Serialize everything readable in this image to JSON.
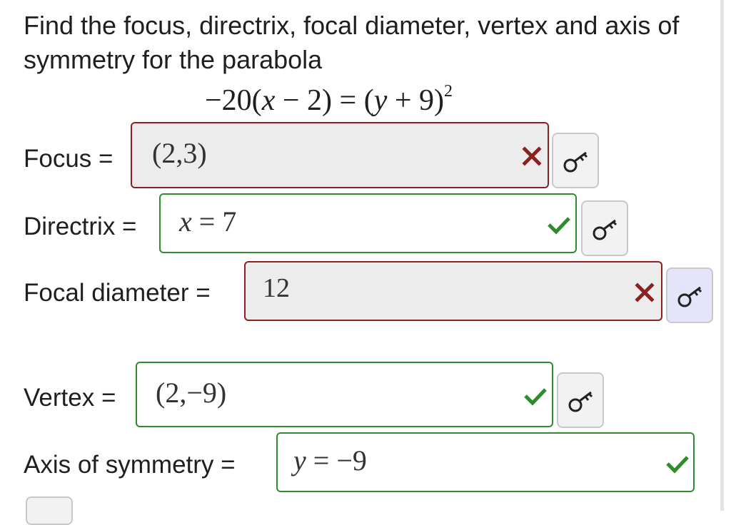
{
  "question": {
    "prompt": "Find the focus, directrix, focal diameter, vertex and axis of symmetry for the parabola",
    "equation": {
      "lhs_coef": "−20(",
      "lhs_var": "x",
      "lhs_rest": " − 2) = (",
      "rhs_var": "y",
      "rhs_rest": " + 9)",
      "exponent": "2"
    }
  },
  "fields": {
    "focus": {
      "label": "Focus =",
      "value": "(2,3)",
      "status": "incorrect"
    },
    "directrix": {
      "label": "Directrix =",
      "value_var": "x",
      "value_rest": " = 7",
      "status": "correct"
    },
    "focal_diameter": {
      "label": "Focal diameter =",
      "value": "12",
      "status": "incorrect"
    },
    "vertex": {
      "label": "Vertex =",
      "value": "(2,−9)",
      "status": "correct"
    },
    "axis_of_symmetry": {
      "label": "Axis of symmetry =",
      "value_var": "y",
      "value_rest": " = −9",
      "status": "correct"
    }
  },
  "colors": {
    "incorrect": "#8b2020",
    "correct": "#2e8b2e",
    "key_icon": "key-icon"
  }
}
